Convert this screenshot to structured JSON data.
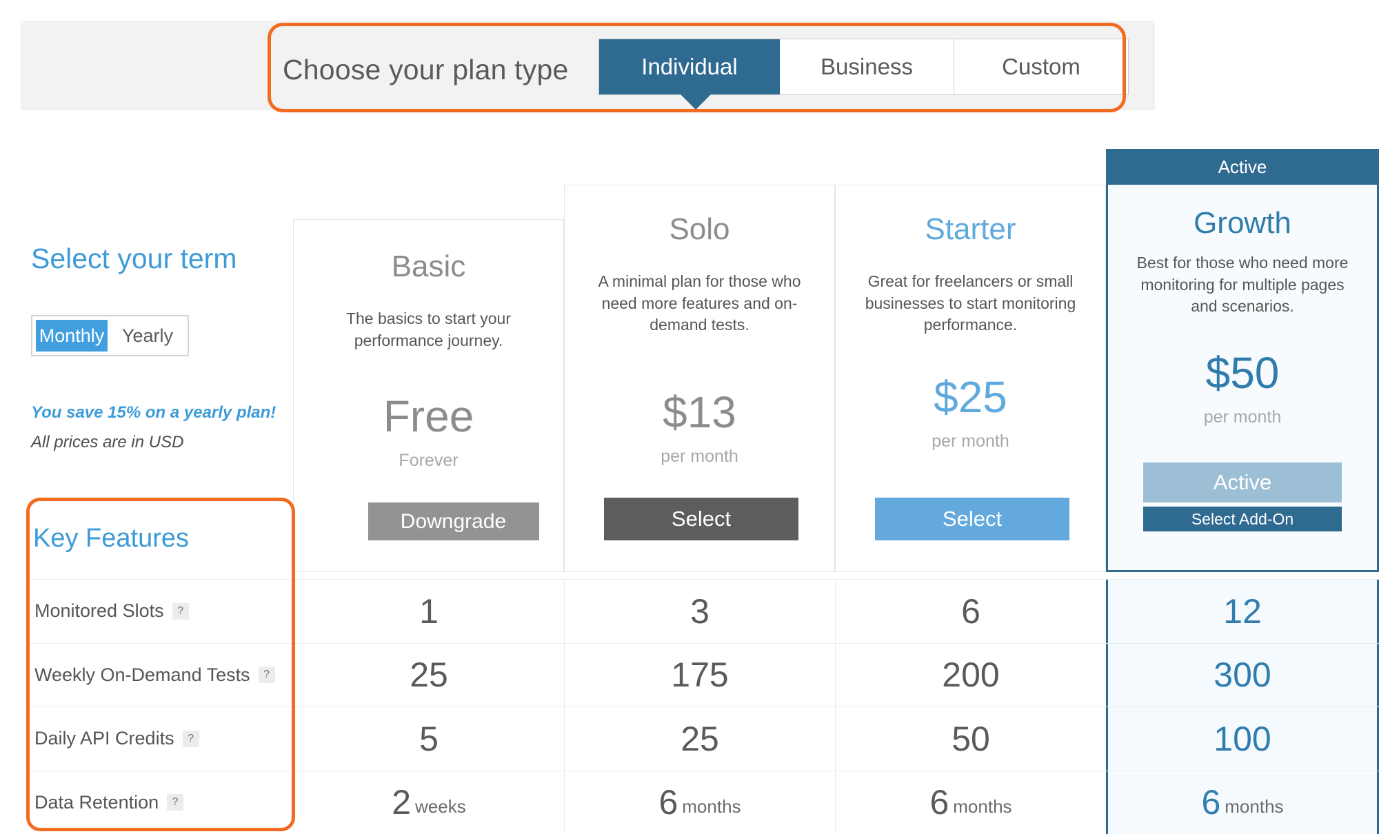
{
  "plan_type": {
    "label": "Choose your plan type",
    "tabs": [
      {
        "label": "Individual",
        "active": true
      },
      {
        "label": "Business",
        "active": false
      },
      {
        "label": "Custom",
        "active": false
      }
    ]
  },
  "term": {
    "title": "Select your term",
    "options": [
      {
        "label": "Monthly",
        "selected": true
      },
      {
        "label": "Yearly",
        "selected": false
      }
    ],
    "save_note": "You save 15% on a yearly plan!",
    "currency_note": "All prices are in USD"
  },
  "key_features": {
    "title": "Key Features",
    "help_glyph": "?"
  },
  "plans": [
    {
      "name": "Basic",
      "description": "The basics to start your performance journey.",
      "price": "Free",
      "period": "Forever",
      "button": "Downgrade",
      "active": false
    },
    {
      "name": "Solo",
      "description": "A minimal plan for those who need more features and on-demand tests.",
      "price": "$13",
      "period": "per month",
      "button": "Select",
      "active": false
    },
    {
      "name": "Starter",
      "description": "Great for freelancers or small businesses to start monitoring performance.",
      "price": "$25",
      "period": "per month",
      "button": "Select",
      "active": false
    },
    {
      "name": "Growth",
      "description": "Best for those who need more monitoring for multiple pages and scenarios.",
      "price": "$50",
      "period": "per month",
      "banner": "Active",
      "button": "Active",
      "addon_button": "Select Add-On",
      "active": true
    }
  ],
  "features": [
    {
      "label": "Monitored Slots",
      "values": [
        {
          "value": "1",
          "unit": ""
        },
        {
          "value": "3",
          "unit": ""
        },
        {
          "value": "6",
          "unit": ""
        },
        {
          "value": "12",
          "unit": ""
        }
      ]
    },
    {
      "label": "Weekly On-Demand Tests",
      "values": [
        {
          "value": "25",
          "unit": ""
        },
        {
          "value": "175",
          "unit": ""
        },
        {
          "value": "200",
          "unit": ""
        },
        {
          "value": "300",
          "unit": ""
        }
      ]
    },
    {
      "label": "Daily API Credits",
      "values": [
        {
          "value": "5",
          "unit": ""
        },
        {
          "value": "25",
          "unit": ""
        },
        {
          "value": "50",
          "unit": ""
        },
        {
          "value": "100",
          "unit": ""
        }
      ]
    },
    {
      "label": "Data Retention",
      "values": [
        {
          "value": "2",
          "unit": "weeks"
        },
        {
          "value": "6",
          "unit": "months"
        },
        {
          "value": "6",
          "unit": "months"
        },
        {
          "value": "6",
          "unit": "months"
        }
      ]
    }
  ],
  "colors": {
    "highlight_orange": "#f26b21",
    "dark_blue": "#2f6a91",
    "light_blue": "#429fdf",
    "starter_blue": "#64a9dd",
    "grey_button": "#939393"
  }
}
